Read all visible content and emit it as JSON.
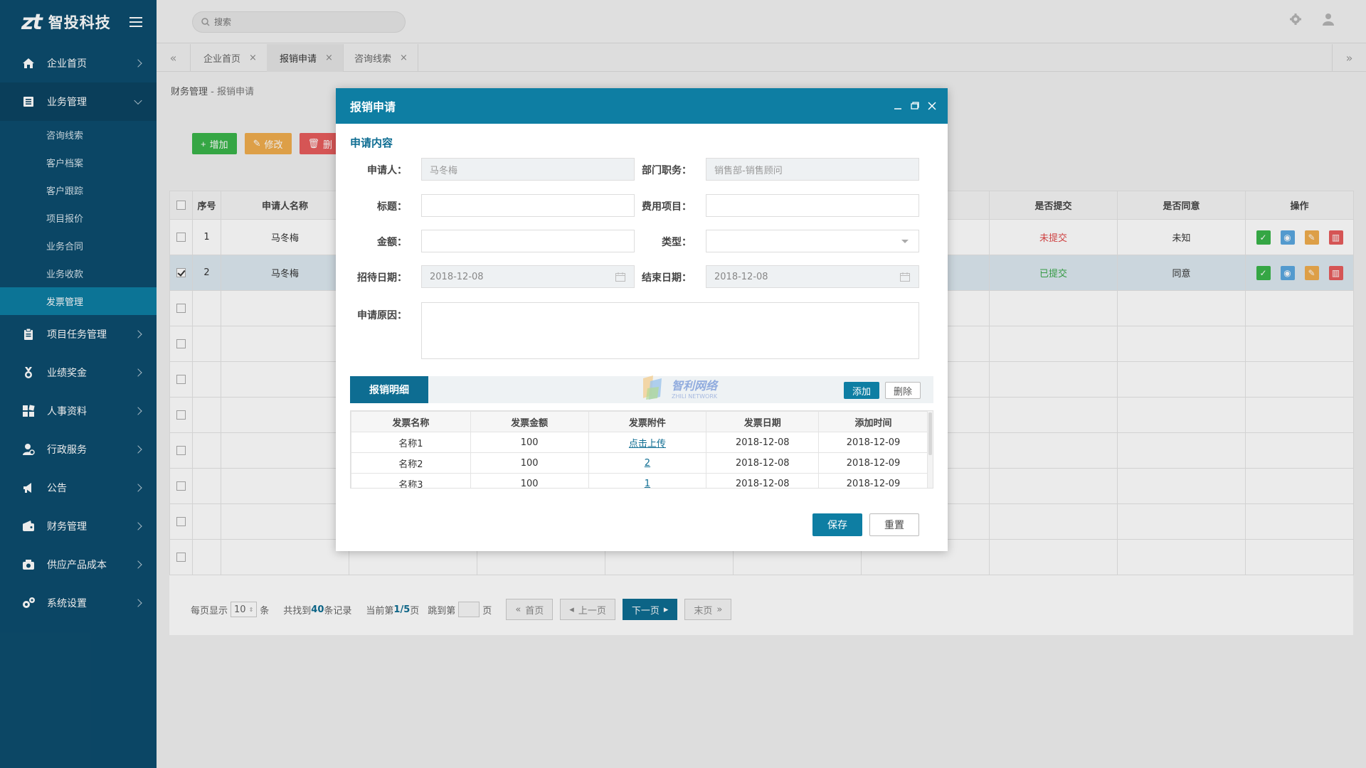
{
  "app": {
    "logo_mark": "zt",
    "logo_name": "智投科技"
  },
  "header": {
    "search_placeholder": "搜索"
  },
  "sidebar": {
    "items": [
      {
        "label": "企业首页",
        "icon": "home-icon"
      },
      {
        "label": "业务管理",
        "icon": "list-icon",
        "open": true
      },
      {
        "label": "项目任务管理",
        "icon": "clipboard-icon"
      },
      {
        "label": "业绩奖金",
        "icon": "medal-icon"
      },
      {
        "label": "人事资料",
        "icon": "grid-icon"
      },
      {
        "label": "行政服务",
        "icon": "person-icon"
      },
      {
        "label": "公告",
        "icon": "megaphone-icon"
      },
      {
        "label": "财务管理",
        "icon": "wallet-icon"
      },
      {
        "label": "供应产品成本",
        "icon": "box-icon"
      },
      {
        "label": "系统设置",
        "icon": "gears-icon"
      }
    ],
    "sub_items": [
      "咨询线索",
      "客户档案",
      "客户跟踪",
      "项目报价",
      "业务合同",
      "业务收款",
      "发票管理"
    ]
  },
  "tabs": [
    {
      "label": "企业首页",
      "close": "×"
    },
    {
      "label": "报销申请",
      "close": "×"
    },
    {
      "label": "咨询线索",
      "close": "×"
    }
  ],
  "breadcrumb": {
    "parent": "财务管理",
    "sep": " - ",
    "current": "报销申请"
  },
  "toolbar": {
    "add": "增加",
    "edit": "修改",
    "delete_partial": "删"
  },
  "grid": {
    "headers": [
      "序号",
      "申请人名称",
      "是否提交",
      "是否同意",
      "操作"
    ],
    "rows": [
      {
        "no": "1",
        "name": "马冬梅",
        "submitted": "未提交",
        "agreed": "未知"
      },
      {
        "no": "2",
        "name": "马冬梅",
        "submitted": "已提交",
        "agreed": "同意"
      }
    ]
  },
  "pager": {
    "per_page_label": "每页显示",
    "per_page": "10",
    "per_page_unit": "条",
    "found_pre": "共找到",
    "found_count": "40",
    "found_post": "条记录",
    "current_pre": "当前第",
    "current": "1/5",
    "current_post": "页",
    "jump_pre": "跳到第",
    "jump_post": "页",
    "first": "首页",
    "prev": "上一页",
    "next": "下一页",
    "last": "末页"
  },
  "modal": {
    "title": "报销申请",
    "section": "申请内容",
    "fields": {
      "applicant_label": "申请人：",
      "applicant_value": "马冬梅",
      "dept_label": "部门职务：",
      "dept_value": "销售部-销售顾问",
      "title_label": "标题：",
      "cost_item_label": "费用项目：",
      "amount_label": "金额：",
      "type_label": "类型：",
      "start_label": "招待日期：",
      "start_value": "2018-12-08",
      "end_label": "结束日期：",
      "end_value": "2018-12-08",
      "reason_label": "申请原因："
    },
    "detail": {
      "tab": "报销明细",
      "add": "添加",
      "delete": "删除",
      "headers": [
        "发票名称",
        "发票金额",
        "发票附件",
        "发票日期",
        "添加时间"
      ],
      "rows": [
        {
          "name": "名称1",
          "amount": "100",
          "attach": "点击上传",
          "date": "2018-12-08",
          "added": "2018-12-09"
        },
        {
          "name": "名称2",
          "amount": "100",
          "attach": "2",
          "date": "2018-12-08",
          "added": "2018-12-09"
        },
        {
          "name": "名称3",
          "amount": "100",
          "attach": "1",
          "date": "2018-12-08",
          "added": "2018-12-09"
        }
      ]
    },
    "save": "保存",
    "reset": "重置"
  },
  "watermark": {
    "line1": "智利网络",
    "line2": "ZHILI NETWORK"
  }
}
